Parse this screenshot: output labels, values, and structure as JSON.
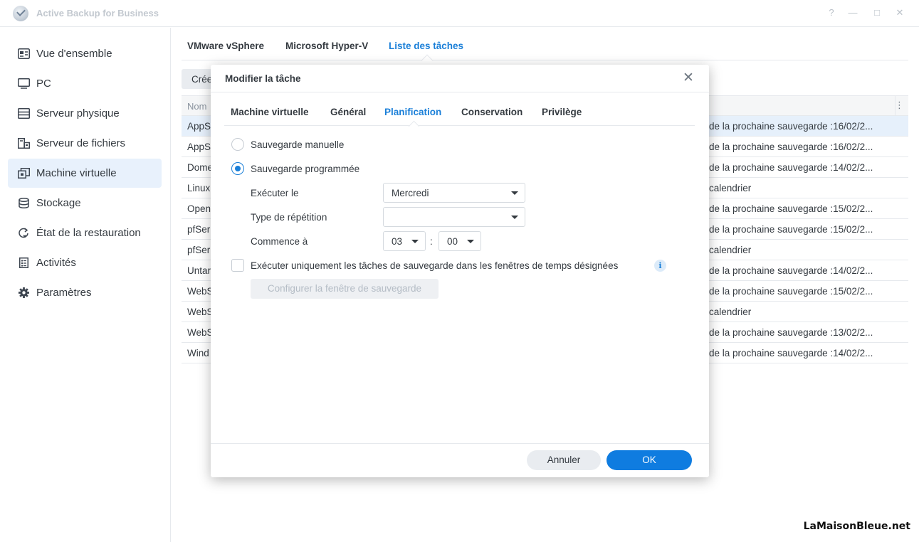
{
  "app": {
    "title": "Active Backup for Business"
  },
  "window": {
    "help": "?",
    "minimize": "—",
    "maximize": "□",
    "close": "✕"
  },
  "sidebar": {
    "items": [
      {
        "label": "Vue d'ensemble",
        "icon": "overview-icon"
      },
      {
        "label": "PC",
        "icon": "monitor-icon"
      },
      {
        "label": "Serveur physique",
        "icon": "server-icon"
      },
      {
        "label": "Serveur de fichiers",
        "icon": "file-server-icon"
      },
      {
        "label": "Machine virtuelle",
        "icon": "virtual-machine-icon",
        "active": true
      },
      {
        "label": "Stockage",
        "icon": "storage-icon"
      },
      {
        "label": "État de la restauration",
        "icon": "restore-icon"
      },
      {
        "label": "Activités",
        "icon": "activities-icon"
      },
      {
        "label": "Paramètres",
        "icon": "gear-icon"
      }
    ]
  },
  "main": {
    "tabs": [
      {
        "label": "VMware vSphere"
      },
      {
        "label": "Microsoft Hyper-V"
      },
      {
        "label": "Liste des tâches",
        "active": true
      }
    ],
    "create_label": "Créer",
    "table": {
      "name_header": "Nom",
      "more": "⋮",
      "rows": [
        {
          "name": "AppS",
          "schedule": "de la prochaine sauvegarde :16/02/2..."
        },
        {
          "name": "AppS",
          "schedule": "de la prochaine sauvegarde :16/02/2..."
        },
        {
          "name": "Dome",
          "schedule": "de la prochaine sauvegarde :14/02/2..."
        },
        {
          "name": "Linux",
          "schedule": "calendrier"
        },
        {
          "name": "Open",
          "schedule": "de la prochaine sauvegarde :15/02/2..."
        },
        {
          "name": "pfSer",
          "schedule": "de la prochaine sauvegarde :15/02/2..."
        },
        {
          "name": "pfSer",
          "schedule": "calendrier"
        },
        {
          "name": "Untar",
          "schedule": "de la prochaine sauvegarde :14/02/2..."
        },
        {
          "name": "WebS",
          "schedule": "de la prochaine sauvegarde :15/02/2..."
        },
        {
          "name": "WebS",
          "schedule": "calendrier"
        },
        {
          "name": "WebS",
          "schedule": "de la prochaine sauvegarde :13/02/2..."
        },
        {
          "name": "Wind",
          "schedule": "de la prochaine sauvegarde :14/02/2..."
        }
      ]
    }
  },
  "dialog": {
    "title": "Modifier la tâche",
    "close": "✕",
    "tabs": [
      {
        "label": "Machine virtuelle"
      },
      {
        "label": "Général"
      },
      {
        "label": "Planification",
        "active": true
      },
      {
        "label": "Conservation"
      },
      {
        "label": "Privilège"
      }
    ],
    "manual_label": "Sauvegarde manuelle",
    "scheduled_label": "Sauvegarde programmée",
    "run_on_label": "Exécuter le",
    "run_on_value": "Mercredi",
    "repeat_label": "Type de répétition",
    "repeat_value": "",
    "start_label": "Commence à",
    "start_hour": "03",
    "time_sep": ":",
    "start_minute": "00",
    "window_checkbox_label": "Exécuter uniquement les tâches de sauvegarde dans les fenêtres de temps désignées",
    "info": "i",
    "configure_window_label": "Configurer la fenêtre de sauvegarde",
    "cancel_label": "Annuler",
    "ok_label": "OK"
  },
  "watermark": "LaMaisonBleue.net"
}
